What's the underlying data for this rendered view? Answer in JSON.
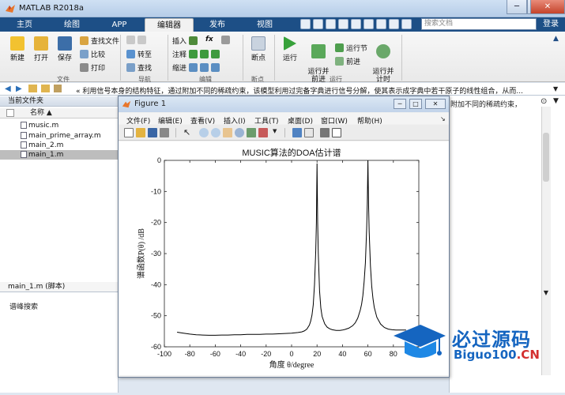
{
  "window": {
    "title": "MATLAB R2018a"
  },
  "tabs": [
    {
      "label": "主页"
    },
    {
      "label": "绘图"
    },
    {
      "label": "APP"
    },
    {
      "label": "编辑器"
    },
    {
      "label": "发布"
    },
    {
      "label": "视图"
    }
  ],
  "search": {
    "placeholder": "搜索文档"
  },
  "login": {
    "label": "登录"
  },
  "ribbon": {
    "file_group": {
      "new": "新建",
      "open": "打开",
      "save": "保存",
      "find_files": "查找文件",
      "compare": "比较",
      "print": "打印",
      "label": "文件"
    },
    "nav_group": {
      "goto": "转至",
      "find": "查找",
      "label": "导航"
    },
    "edit_group": {
      "insert": "插入",
      "comment": "注释",
      "indent": "缩进",
      "fx": "fx",
      "label": "编辑"
    },
    "breakpoint_group": {
      "breakpoints": "断点",
      "label": "断点"
    },
    "run_group": {
      "run": "运行",
      "run_advance": "运行并\n前进",
      "run_section": "运行节",
      "advance": "前进",
      "run_time": "运行并\n计时",
      "label": "运行"
    }
  },
  "address": {
    "text": "« 利用信号本身的结构特征，通过附加不同的稀疏约束，该模型利用过完备字典进行信号分解，使其表示成字典中若干原子的线性组合，从而..."
  },
  "current_folder": {
    "title": "当前文件夹",
    "column": "名称 ▲",
    "files": [
      {
        "name": "music.m"
      },
      {
        "name": "main_prime_array.m"
      },
      {
        "name": "main_2.m"
      },
      {
        "name": "main_1.m",
        "selected": true
      }
    ],
    "details_title": "main_1.m  (脚本)",
    "details_body": "谱峰搜索"
  },
  "right_panel": {
    "text": "附加不同的稀疏约束，"
  },
  "figure": {
    "title": "Figure 1",
    "menu": [
      "文件(F)",
      "编辑(E)",
      "查看(V)",
      "插入(I)",
      "工具(T)",
      "桌面(D)",
      "窗口(W)",
      "帮助(H)"
    ]
  },
  "chart_data": {
    "type": "line",
    "title": "MUSIC算法的DOA估计谱",
    "xlabel": "角度 θ/degree",
    "ylabel": "谱函数P(θ) /dB",
    "xlim": [
      -100,
      100
    ],
    "ylim": [
      -60,
      0
    ],
    "xticks": [
      -100,
      -80,
      -60,
      -40,
      -20,
      0,
      20,
      40,
      60,
      80,
      100
    ],
    "yticks": [
      0,
      -10,
      -20,
      -30,
      -40,
      -50,
      -60
    ],
    "grid": false,
    "series": [
      {
        "x": [
          -90,
          -85,
          -80,
          -75,
          -70,
          -65,
          -60,
          -55,
          -50,
          -45,
          -40,
          -35,
          -30,
          -25,
          -20,
          -15,
          -10,
          -5,
          0,
          5,
          8,
          10,
          12,
          14,
          15,
          16,
          17,
          18,
          19,
          19.5,
          20,
          20.5,
          21,
          22,
          23,
          24,
          26,
          28,
          30,
          32,
          35,
          38,
          40,
          42,
          45,
          48,
          50,
          52,
          54,
          55,
          56,
          57,
          58,
          59,
          59.5,
          60,
          60.5,
          61,
          62,
          63,
          64,
          65,
          67,
          70,
          73,
          76,
          79,
          82,
          85,
          88,
          90
        ],
        "y": [
          -55.3,
          -55.6,
          -55.9,
          -56.1,
          -56.2,
          -56.3,
          -56.3,
          -56.2,
          -56.2,
          -56.1,
          -56.1,
          -56.0,
          -56.0,
          -56.0,
          -55.9,
          -55.9,
          -55.8,
          -55.7,
          -55.6,
          -55.4,
          -55.2,
          -54.9,
          -54.3,
          -53.0,
          -51.8,
          -49.8,
          -46.5,
          -40.0,
          -29.0,
          -20.0,
          -1.0,
          -20.0,
          -30.0,
          -42.0,
          -47.5,
          -50.2,
          -52.6,
          -53.7,
          -54.2,
          -54.5,
          -54.7,
          -54.7,
          -54.6,
          -54.4,
          -54.0,
          -53.2,
          -52.3,
          -50.8,
          -48.2,
          -46.3,
          -43.5,
          -39.0,
          -33.0,
          -22.0,
          -14.0,
          0.0,
          -14.0,
          -23.0,
          -34.0,
          -40.5,
          -44.5,
          -47.3,
          -50.5,
          -52.7,
          -53.8,
          -54.3,
          -54.5,
          -54.6,
          -54.6,
          -54.6,
          -54.6
        ]
      }
    ]
  },
  "watermark": {
    "brand": "必过源码",
    "url_main": "Biguo100",
    "url_suffix": ".CN"
  }
}
